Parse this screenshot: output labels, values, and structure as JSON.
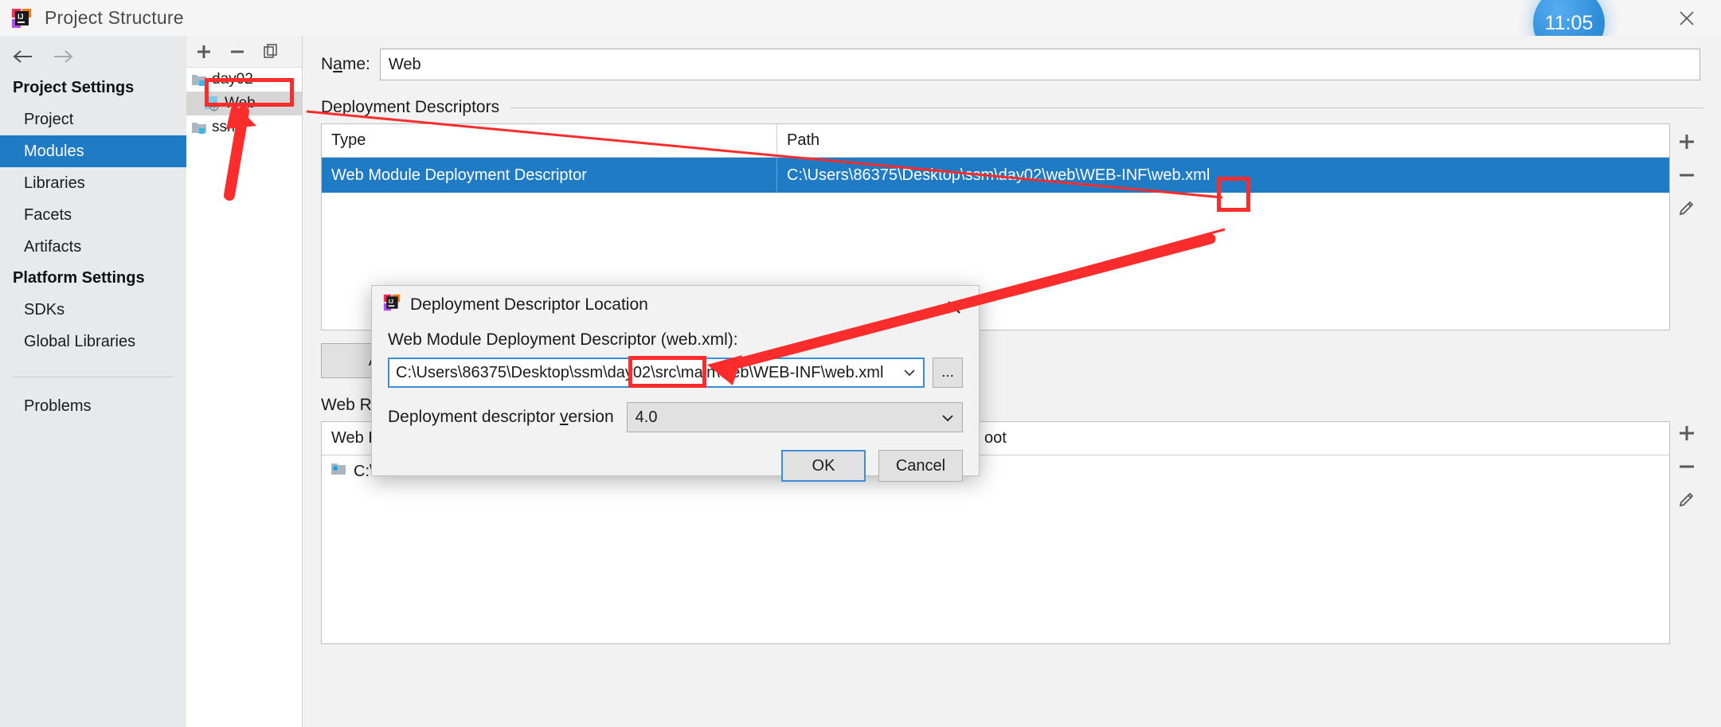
{
  "window": {
    "title": "Project Structure",
    "close_icon": "close-icon",
    "logo_icon": "intellij-logo-icon",
    "clock_badge": "11:05"
  },
  "nav": {
    "back_icon": "arrow-left-icon",
    "forward_icon": "arrow-right-icon"
  },
  "sidebar": {
    "groups": [
      {
        "label": "Project Settings",
        "items": [
          {
            "label": "Project",
            "selected": false
          },
          {
            "label": "Modules",
            "selected": true
          },
          {
            "label": "Libraries",
            "selected": false
          },
          {
            "label": "Facets",
            "selected": false
          },
          {
            "label": "Artifacts",
            "selected": false
          }
        ]
      },
      {
        "label": "Platform Settings",
        "items": [
          {
            "label": "SDKs",
            "selected": false
          },
          {
            "label": "Global Libraries",
            "selected": false
          }
        ]
      }
    ],
    "problems_label": "Problems"
  },
  "module_tree": {
    "toolbar": {
      "add_icon": "plus-icon",
      "remove_icon": "minus-icon",
      "copy_icon": "copy-icon"
    },
    "nodes": [
      {
        "label": "day02",
        "icon": "folder-module-icon",
        "indent": 0,
        "selected": false
      },
      {
        "label": "Web",
        "icon": "web-facet-icon",
        "indent": 1,
        "selected": true
      },
      {
        "label": "ssm",
        "icon": "folder-module-icon",
        "indent": 0,
        "selected": false
      }
    ]
  },
  "main": {
    "name_label": "Name:",
    "name_value": "Web",
    "deployment": {
      "legend": "Deployment Descriptors",
      "columns": [
        "Type",
        "Path"
      ],
      "rows": [
        {
          "type": "Web Module Deployment Descriptor",
          "path": "C:\\Users\\86375\\Desktop\\ssm\\day02\\web\\WEB-INF\\web.xml",
          "selected": true
        }
      ],
      "side_buttons": [
        {
          "name": "add-descriptor-button",
          "icon": "plus-icon",
          "highlight": false
        },
        {
          "name": "remove-descriptor-button",
          "icon": "minus-icon",
          "highlight": false
        },
        {
          "name": "edit-descriptor-button",
          "icon": "pencil-icon",
          "highlight": true
        }
      ]
    },
    "add_application_server_button": "Add Ap",
    "web_resource": {
      "legend": "Web Resc",
      "columns": [
        "Web Re",
        "oot"
      ],
      "rows": [
        {
          "icon": "web-folder-icon",
          "value": "C:\\Us"
        }
      ],
      "side_buttons": [
        {
          "name": "add-web-resource-button",
          "icon": "plus-icon"
        },
        {
          "name": "remove-web-resource-button",
          "icon": "minus-icon"
        },
        {
          "name": "edit-web-resource-button",
          "icon": "pencil-icon"
        }
      ]
    }
  },
  "modal": {
    "title": "Deployment Descriptor Location",
    "logo_icon": "intellij-logo-icon",
    "close_icon": "close-icon",
    "field_label": "Web Module Deployment Descriptor (web.xml):",
    "path_value": "C:\\Users\\86375\\Desktop\\ssm\\day02\\src\\main\\web\\WEB-INF\\web.xml",
    "browse_label": "...",
    "version_label": "Deployment descriptor version",
    "version_value": "4.0",
    "ok_label": "OK",
    "cancel_label": "Cancel"
  },
  "colors": {
    "selection_blue": "#1f7cc4",
    "annotation_red": "#fb2c2c",
    "sidebar_bg": "#e6eaed",
    "focus_border": "#3b8ede"
  }
}
